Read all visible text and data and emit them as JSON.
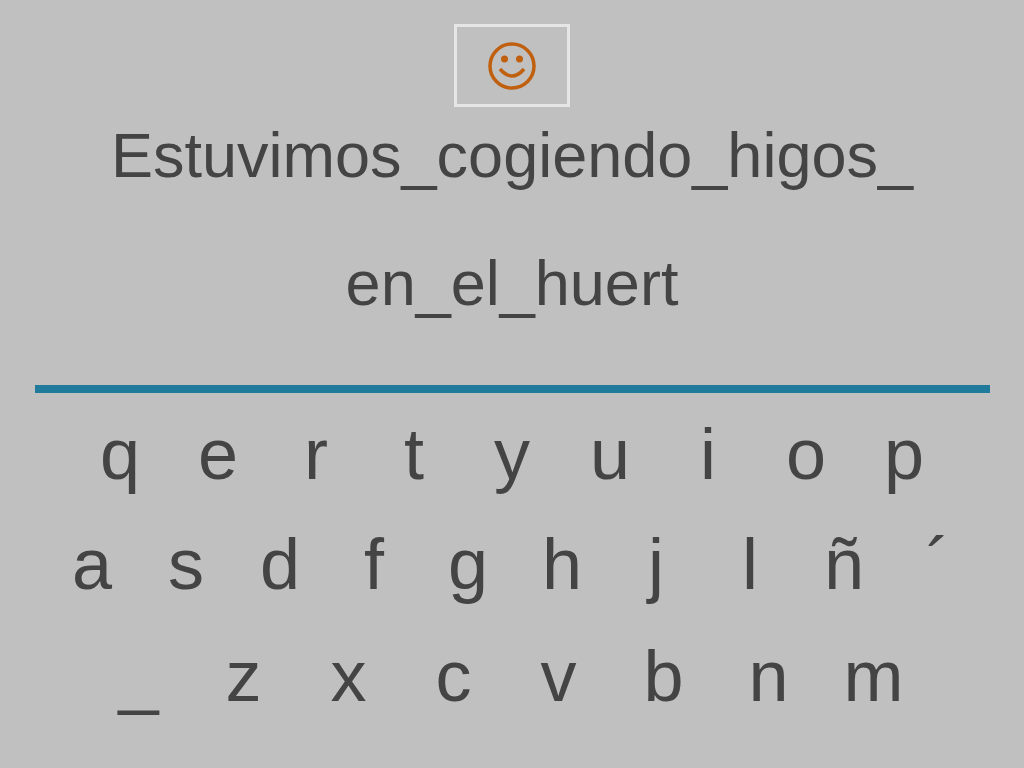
{
  "sentence_lines": [
    "Estuvimos_cogiendo_higos_",
    "en_el_huert"
  ],
  "keyboard_rows": [
    [
      "q",
      "e",
      "r",
      "t",
      "y",
      "u",
      "i",
      "o",
      "p"
    ],
    [
      "a",
      "s",
      "d",
      "f",
      "g",
      "h",
      "j",
      "l",
      "ñ",
      "´"
    ],
    [
      "_",
      "z",
      "x",
      "c",
      "v",
      "b",
      "n",
      "m"
    ]
  ]
}
